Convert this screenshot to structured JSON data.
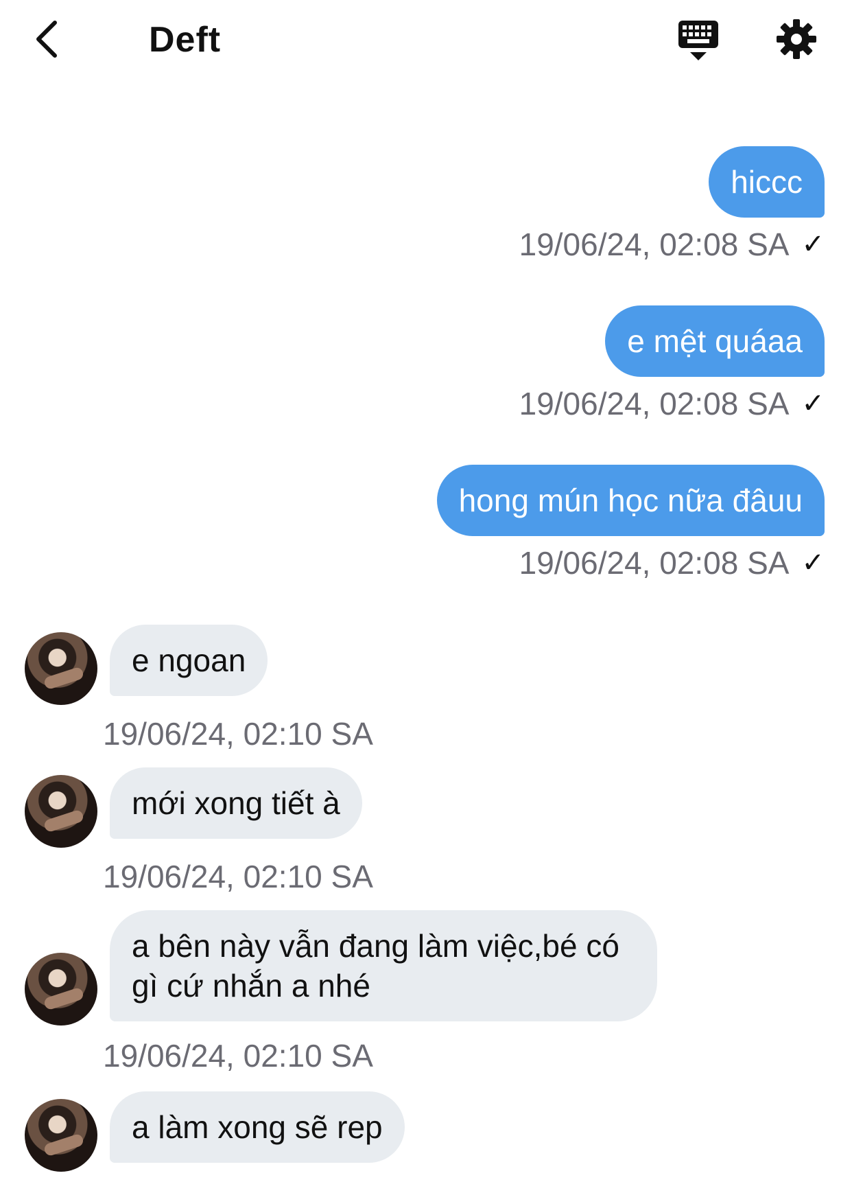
{
  "header": {
    "back_icon": "chevron-left-icon",
    "title": "Deft",
    "keyboard_icon": "keyboard-icon",
    "settings_icon": "gear-icon"
  },
  "messages": {
    "outgoing": [
      {
        "text": "hiccc",
        "time": "19/06/24, 02:08 SA",
        "status": "✓"
      },
      {
        "text": "e mệt quáaa",
        "time": "19/06/24, 02:08 SA",
        "status": "✓"
      },
      {
        "text": "hong mún học nữa đâuu",
        "time": "19/06/24, 02:08 SA",
        "status": "✓"
      }
    ],
    "incoming": [
      {
        "text": "e ngoan",
        "time": "19/06/24, 02:10 SA"
      },
      {
        "text": "mới xong tiết à",
        "time": "19/06/24, 02:10 SA"
      },
      {
        "text": "a bên này vẫn đang làm việc,bé có gì cứ nhắn a nhé",
        "time": "19/06/24, 02:10 SA"
      },
      {
        "text": "a làm xong sẽ rep",
        "time": ""
      }
    ]
  },
  "colors": {
    "outgoing_bubble": "#4c9bea",
    "incoming_bubble": "#e8ecf0",
    "meta_text": "#6b6b73"
  }
}
